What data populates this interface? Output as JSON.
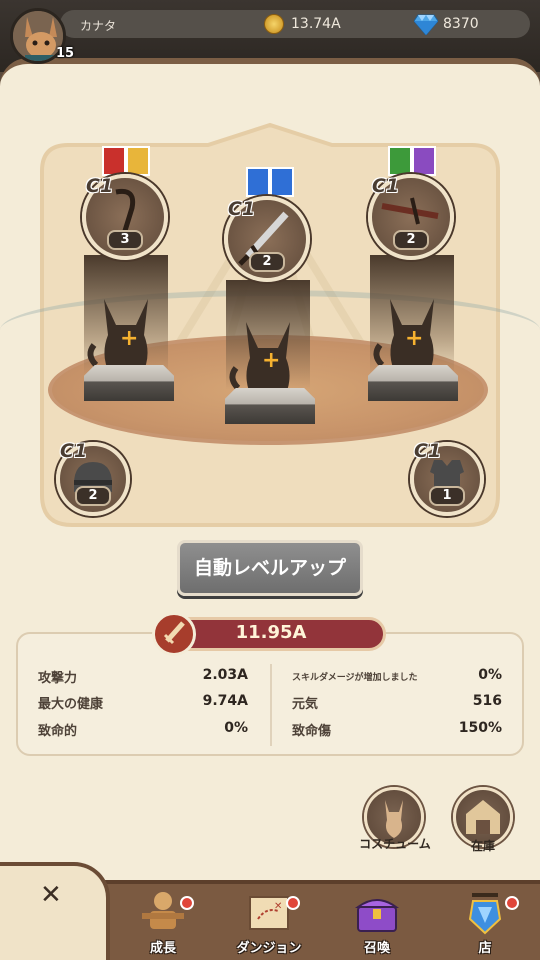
{
  "player": {
    "name": "カナタ",
    "level": "15"
  },
  "currency": {
    "gold": "13.74A",
    "gems": "8370"
  },
  "weapons": [
    {
      "grade": "C1",
      "count": "3",
      "tag_colors": [
        "#c9302c",
        "#e8b53a"
      ]
    },
    {
      "grade": "C1",
      "count": "2",
      "tag_colors": [
        "#2f6fd6",
        "#2f6fd6"
      ]
    },
    {
      "grade": "C1",
      "count": "2",
      "tag_colors": [
        "#3d9a3a",
        "#8a4bc0"
      ]
    }
  ],
  "armor": [
    {
      "grade": "C1",
      "count": "2"
    },
    {
      "grade": "C1",
      "count": "1"
    }
  ],
  "auto_level_button": "自動レベルアップ",
  "power": "11.95A",
  "stats_left": [
    {
      "label": "攻撃力",
      "value": "2.03A"
    },
    {
      "label": "最大の健康",
      "value": "9.74A"
    },
    {
      "label": "致命的",
      "value": "0%"
    }
  ],
  "stats_right": [
    {
      "label": "スキルダメージが増加しました",
      "value": "0%"
    },
    {
      "label": "元気",
      "value": "516"
    },
    {
      "label": "致命傷",
      "value": "150%"
    }
  ],
  "side_buttons": {
    "costume": "コスチューム",
    "storage": "在庫"
  },
  "nav": {
    "growth": "成長",
    "dungeon": "ダンジョン",
    "summon": "召喚",
    "shop": "店"
  }
}
